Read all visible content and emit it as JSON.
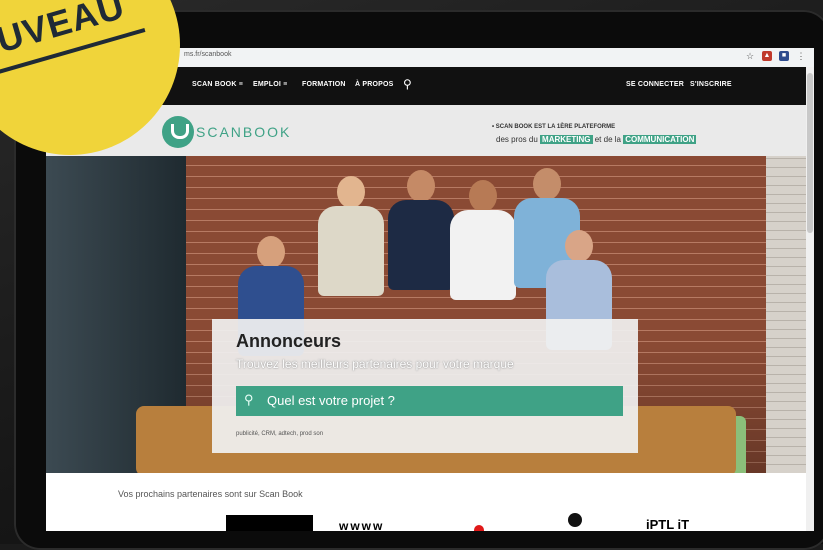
{
  "badge": {
    "text": "UVEAU"
  },
  "browser": {
    "url": "ms.fr/scanbook",
    "icons": [
      "star-icon",
      "extension-icon",
      "extension-icon",
      "menu-dots-icon"
    ]
  },
  "nav": {
    "items": [
      {
        "label": "SCAN BOOK ≡"
      },
      {
        "label": "EMPLOI ≡"
      },
      {
        "label": "FORMATION"
      },
      {
        "label": "À PROPOS"
      }
    ],
    "login": "SE CONNECTER",
    "signup": "S'INSCRIRE"
  },
  "header": {
    "logo": "SCANBOOK",
    "tagline_line1": "• SCAN BOOK EST LA 1ÈRE PLATEFORME",
    "tagline_pre": "des pros du",
    "tagline_hl1": "MARKETING",
    "tagline_mid": "et de la",
    "tagline_hl2": "COMMUNICATION"
  },
  "hero": {
    "title": "Annonceurs",
    "subtitle": "Trouvez les meilleurs partenaires pour votre marque",
    "search_placeholder": "Quel est votre projet ?",
    "hint": "publicité, CRM, adtech, prod son"
  },
  "partners": {
    "title": "Vos prochains partenaires sont sur Scan Book",
    "logo2": "wwww",
    "logo5": "iPTL iT"
  },
  "colors": {
    "accent": "#3fa286",
    "badge": "#f0d43a",
    "nav_bg": "#111111"
  }
}
